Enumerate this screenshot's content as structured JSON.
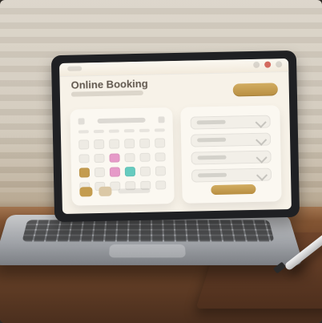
{
  "screen": {
    "title": "Online Booking"
  },
  "colors": {
    "gold": "#c49c4f",
    "pink": "#e69ac8",
    "teal": "#66cbbf",
    "screen_bg": "#f7f2e8"
  }
}
